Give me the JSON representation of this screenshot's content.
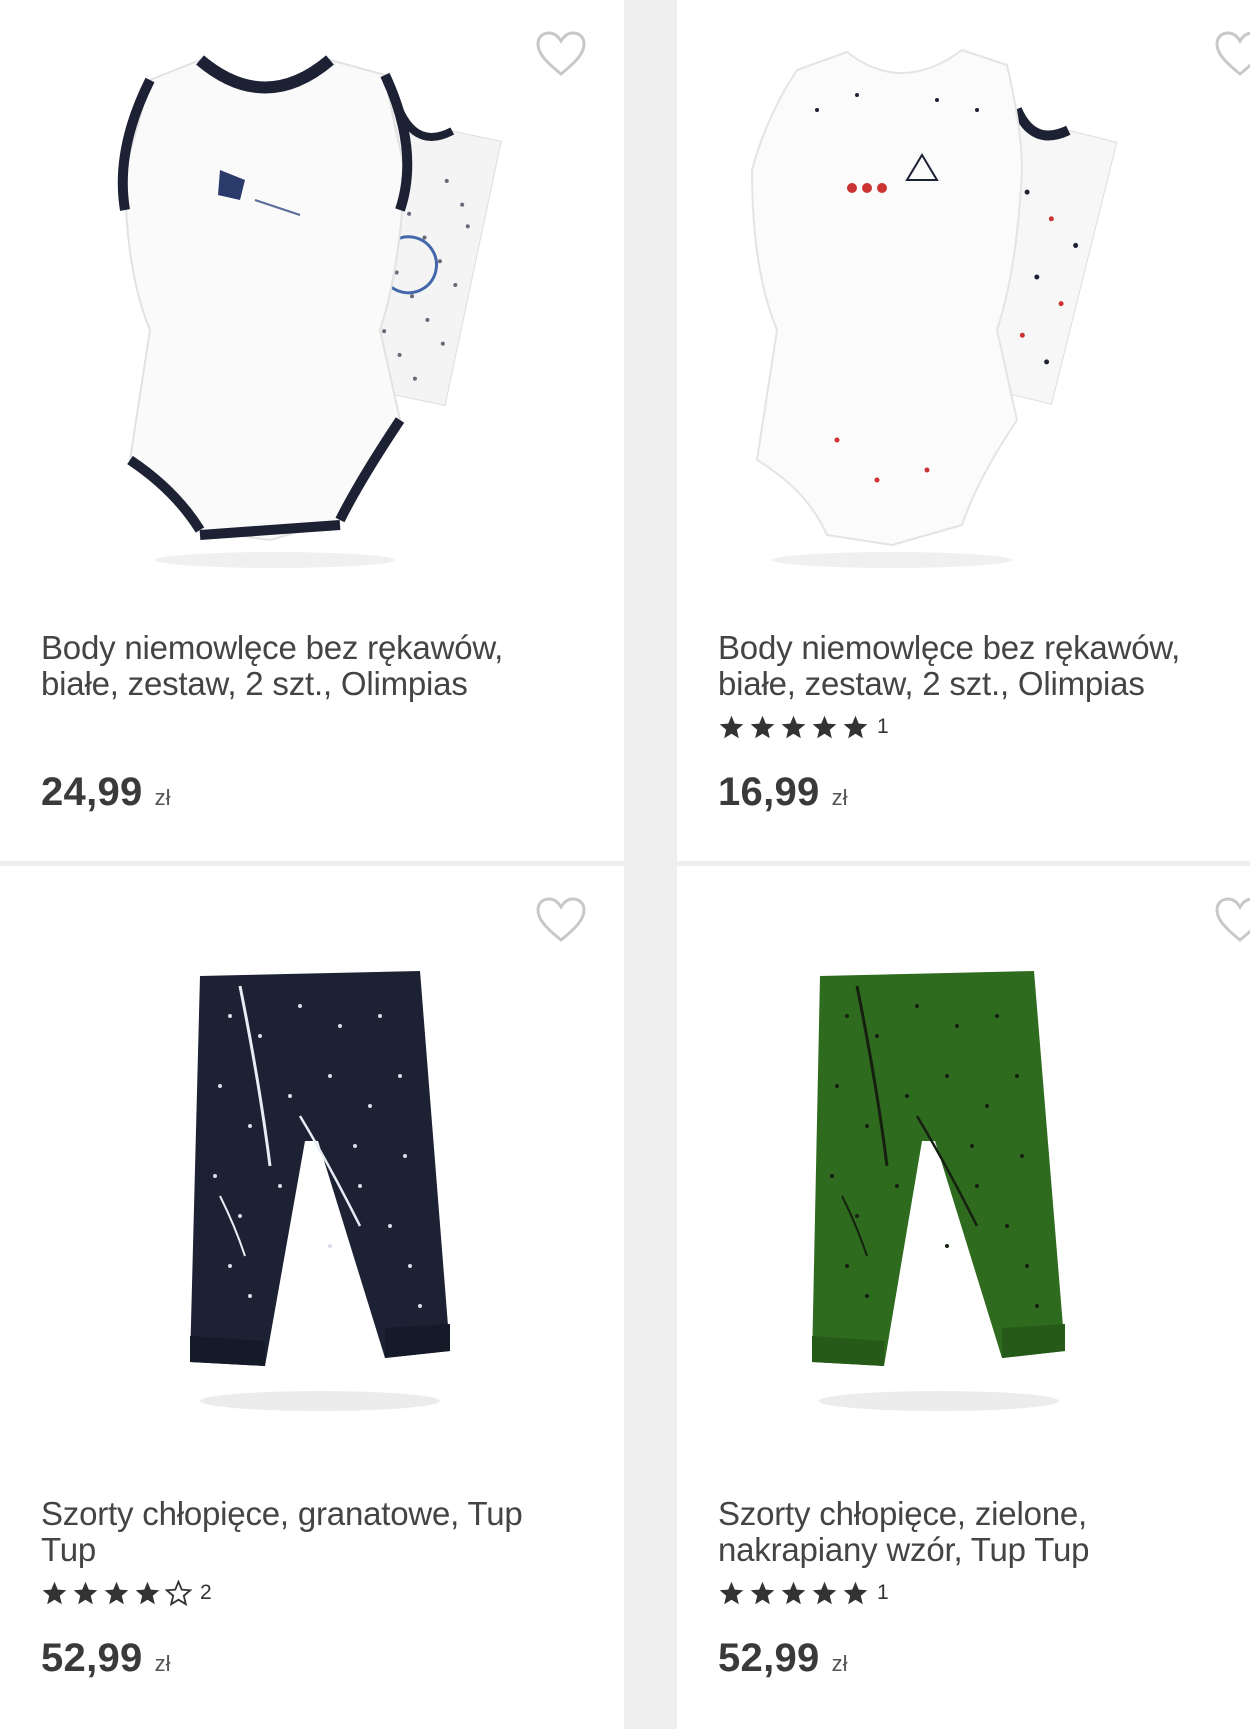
{
  "products": [
    {
      "title": "Body niemowlęce bez rękawów, białe, zestaw, 2 szt., Olimpias",
      "price": "24,99",
      "currency": "zł",
      "image": "baby-bodysuit-navy-trim-icon",
      "rating": null,
      "rating_count": ""
    },
    {
      "title": "Body niemowlęce bez rękawów, białe, zestaw, 2 szt., Olimpias",
      "price": "16,99",
      "currency": "zł",
      "image": "baby-bodysuit-polka-dot-icon",
      "rating": 5,
      "rating_count": "1"
    },
    {
      "title": "Szorty chłopięce, granatowe, Tup Tup",
      "price": "52,99",
      "currency": "zł",
      "image": "navy-shorts-icon",
      "rating": 4,
      "rating_count": "2"
    },
    {
      "title": "Szorty chłopięce, zielone, nakrapiany wzór, Tup Tup",
      "price": "52,99",
      "currency": "zł",
      "image": "green-shorts-icon",
      "rating": 5,
      "rating_count": "1"
    }
  ],
  "colors": {
    "navy": "#1c2233",
    "green": "#2f6b1e",
    "text": "#444444",
    "divider": "#eeeeee"
  }
}
